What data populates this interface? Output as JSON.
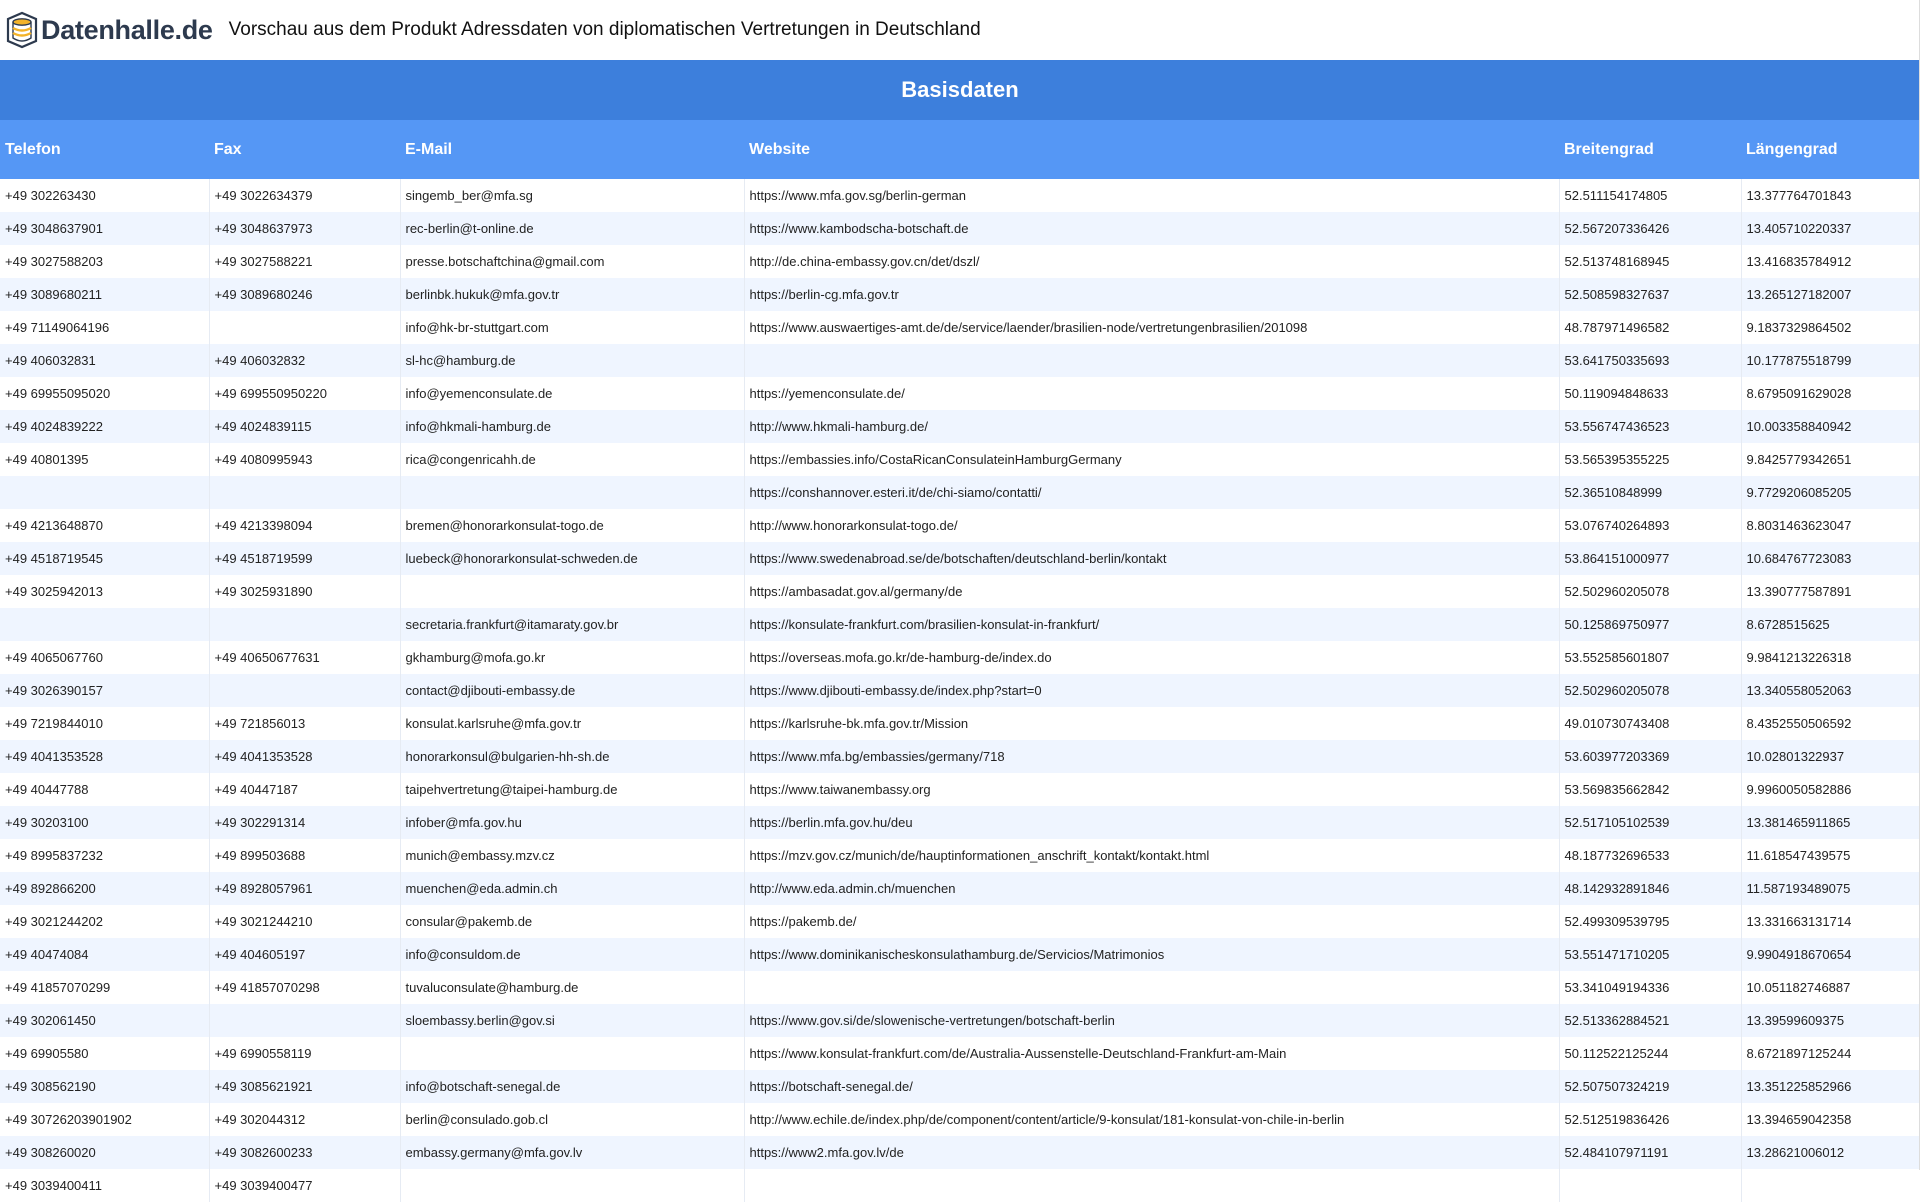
{
  "header": {
    "logo_text": "Datenhalle.de",
    "title": "Vorschau aus dem Produkt Adressdaten von diplomatischen Vertretungen in Deutschland"
  },
  "section": {
    "title": "Basisdaten"
  },
  "table": {
    "columns": [
      "Telefon",
      "Fax",
      "E-Mail",
      "Website",
      "Breitengrad",
      "Längengrad"
    ],
    "rows": [
      [
        "+49 302263430",
        "+49 3022634379",
        "singemb_ber@mfa.sg",
        "https://www.mfa.gov.sg/berlin-german",
        "52.511154174805",
        "13.377764701843"
      ],
      [
        "+49 3048637901",
        "+49 3048637973",
        "rec-berlin@t-online.de",
        "https://www.kambodscha-botschaft.de",
        "52.567207336426",
        "13.405710220337"
      ],
      [
        "+49 3027588203",
        "+49 3027588221",
        "presse.botschaftchina@gmail.com",
        "http://de.china-embassy.gov.cn/det/dszl/",
        "52.513748168945",
        "13.416835784912"
      ],
      [
        "+49 3089680211",
        "+49 3089680246",
        "berlinbk.hukuk@mfa.gov.tr",
        "https://berlin-cg.mfa.gov.tr",
        "52.508598327637",
        "13.265127182007"
      ],
      [
        "+49 71149064196",
        "",
        "info@hk-br-stuttgart.com",
        "https://www.auswaertiges-amt.de/de/service/laender/brasilien-node/vertretungenbrasilien/201098",
        "48.787971496582",
        "9.1837329864502"
      ],
      [
        "+49 406032831",
        "+49 406032832",
        "sl-hc@hamburg.de",
        "",
        "53.641750335693",
        "10.177875518799"
      ],
      [
        "+49 69955095020",
        "+49 699550950220",
        "info@yemenconsulate.de",
        "https://yemenconsulate.de/",
        "50.119094848633",
        "8.6795091629028"
      ],
      [
        "+49 4024839222",
        "+49 4024839115",
        "info@hkmali-hamburg.de",
        "http://www.hkmali-hamburg.de/",
        "53.556747436523",
        "10.003358840942"
      ],
      [
        "+49 40801395",
        "+49 4080995943",
        "rica@congenricahh.de",
        "https://embassies.info/CostaRicanConsulateinHamburgGermany",
        "53.565395355225",
        "9.8425779342651"
      ],
      [
        "",
        "",
        "",
        "https://conshannover.esteri.it/de/chi-siamo/contatti/",
        "52.36510848999",
        "9.7729206085205"
      ],
      [
        "+49 4213648870",
        "+49 4213398094",
        "bremen@honorarkonsulat-togo.de",
        "http://www.honorarkonsulat-togo.de/",
        "53.076740264893",
        "8.8031463623047"
      ],
      [
        "+49 4518719545",
        "+49 4518719599",
        "luebeck@honorarkonsulat-schweden.de",
        "https://www.swedenabroad.se/de/botschaften/deutschland-berlin/kontakt",
        "53.864151000977",
        "10.684767723083"
      ],
      [
        "+49 3025942013",
        "+49 3025931890",
        "",
        "https://ambasadat.gov.al/germany/de",
        "52.502960205078",
        "13.390777587891"
      ],
      [
        "",
        "",
        "secretaria.frankfurt@itamaraty.gov.br",
        "https://konsulate-frankfurt.com/brasilien-konsulat-in-frankfurt/",
        "50.125869750977",
        "8.6728515625"
      ],
      [
        "+49 4065067760",
        "+49 40650677631",
        "gkhamburg@mofa.go.kr",
        "https://overseas.mofa.go.kr/de-hamburg-de/index.do",
        "53.552585601807",
        "9.9841213226318"
      ],
      [
        "+49 3026390157",
        "",
        "contact@djibouti-embassy.de",
        "https://www.djibouti-embassy.de/index.php?start=0",
        "52.502960205078",
        "13.340558052063"
      ],
      [
        "+49 7219844010",
        "+49 721856013",
        "konsulat.karlsruhe@mfa.gov.tr",
        "https://karlsruhe-bk.mfa.gov.tr/Mission",
        "49.010730743408",
        "8.4352550506592"
      ],
      [
        "+49 4041353528",
        "+49 4041353528",
        "honorarkonsul@bulgarien-hh-sh.de",
        "https://www.mfa.bg/embassies/germany/718",
        "53.603977203369",
        "10.02801322937"
      ],
      [
        "+49 40447788",
        "+49 40447187",
        "taipehvertretung@taipei-hamburg.de",
        "https://www.taiwanembassy.org",
        "53.569835662842",
        "9.9960050582886"
      ],
      [
        "+49 30203100",
        "+49 302291314",
        "infober@mfa.gov.hu",
        "https://berlin.mfa.gov.hu/deu",
        "52.517105102539",
        "13.381465911865"
      ],
      [
        "+49 8995837232",
        "+49 899503688",
        "munich@embassy.mzv.cz",
        "https://mzv.gov.cz/munich/de/hauptinformationen_anschrift_kontakt/kontakt.html",
        "48.187732696533",
        "11.618547439575"
      ],
      [
        "+49 892866200",
        "+49 8928057961",
        "muenchen@eda.admin.ch",
        "http://www.eda.admin.ch/muenchen",
        "48.142932891846",
        "11.587193489075"
      ],
      [
        "+49 3021244202",
        "+49 3021244210",
        "consular@pakemb.de",
        "https://pakemb.de/",
        "52.499309539795",
        "13.331663131714"
      ],
      [
        "+49 40474084",
        "+49 404605197",
        "info@consuldom.de",
        "https://www.dominikanischeskonsulathamburg.de/Servicios/Matrimonios",
        "53.551471710205",
        "9.9904918670654"
      ],
      [
        "+49 41857070299",
        "+49 41857070298",
        "tuvaluconsulate@hamburg.de",
        "",
        "53.341049194336",
        "10.051182746887"
      ],
      [
        "+49 302061450",
        "",
        "sloembassy.berlin@gov.si",
        "https://www.gov.si/de/slowenische-vertretungen/botschaft-berlin",
        "52.513362884521",
        "13.39599609375"
      ],
      [
        "+49 69905580",
        "+49 6990558119",
        "",
        "https://www.konsulat-frankfurt.com/de/Australia-Aussenstelle-Deutschland-Frankfurt-am-Main",
        "50.112522125244",
        "8.6721897125244"
      ],
      [
        "+49 308562190",
        "+49 3085621921",
        "info@botschaft-senegal.de",
        "https://botschaft-senegal.de/",
        "52.507507324219",
        "13.351225852966"
      ],
      [
        "+49 30726203901902",
        "+49 302044312",
        "berlin@consulado.gob.cl",
        "http://www.echile.de/index.php/de/component/content/article/9-konsulat/181-konsulat-von-chile-in-berlin",
        "52.512519836426",
        "13.394659042358"
      ],
      [
        "+49 308260020",
        "+49 3082600233",
        "embassy.germany@mfa.gov.lv",
        "https://www2.mfa.gov.lv/de",
        "52.484107971191",
        "13.28621006012"
      ],
      [
        "+49 3039400411",
        "+49 3039400477",
        "",
        "",
        "",
        ""
      ]
    ]
  }
}
